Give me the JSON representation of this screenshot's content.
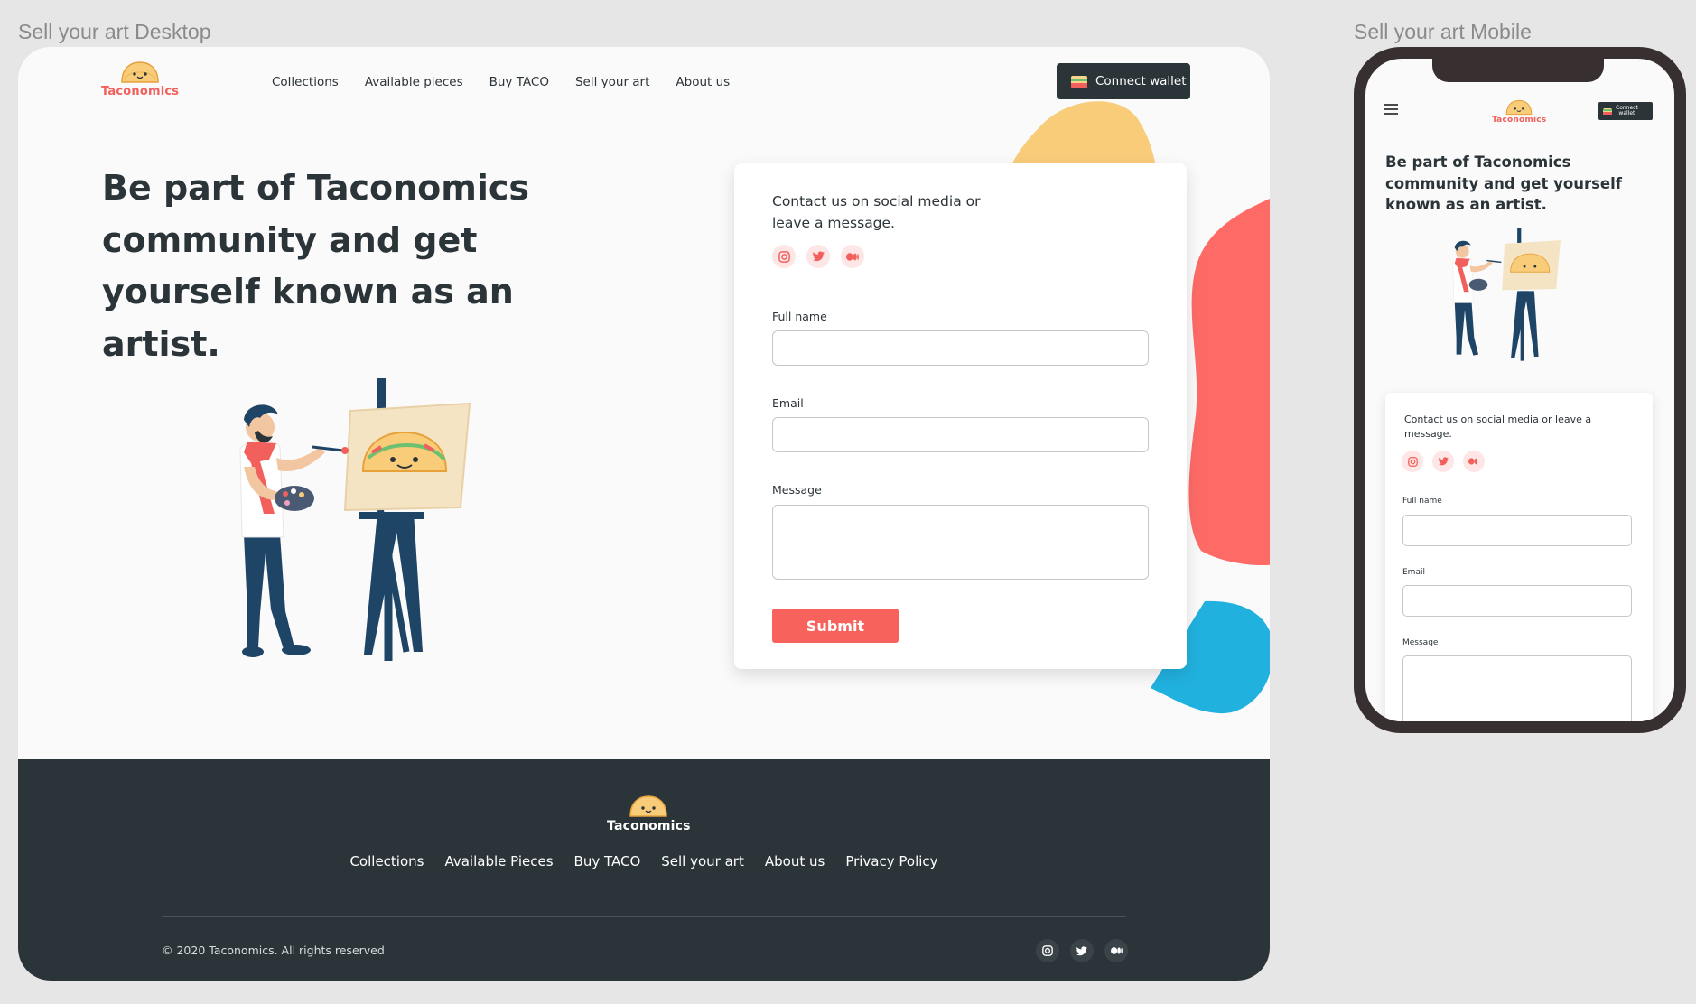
{
  "frames": {
    "desktop_label": "Sell your art Desktop",
    "mobile_label": "Sell your art Mobile"
  },
  "brand": {
    "name": "Taconomics",
    "accent": "#f1605c",
    "dark": "#2b3438",
    "yellow": "#f9cc7a",
    "blue": "#21b1df"
  },
  "nav": {
    "items": [
      {
        "label": "Collections"
      },
      {
        "label": "Available pieces"
      },
      {
        "label": "Buy TACO"
      },
      {
        "label": "Sell your art"
      },
      {
        "label": "About us"
      }
    ],
    "connect_wallet": "Connect wallet"
  },
  "hero": {
    "title": "Be part of Taconomics community and get yourself known as an artist."
  },
  "form": {
    "intro": "Contact us on social media or leave a message.",
    "socials": [
      {
        "icon": "instagram-icon"
      },
      {
        "icon": "twitter-icon"
      },
      {
        "icon": "medium-icon"
      }
    ],
    "full_name_label": "Full name",
    "full_name_value": "",
    "email_label": "Email",
    "email_value": "",
    "message_label": "Message",
    "message_value": "",
    "submit_label": "Submit"
  },
  "footer": {
    "brand": "Taconomics",
    "links": [
      {
        "label": "Collections"
      },
      {
        "label": "Available Pieces"
      },
      {
        "label": "Buy TACO"
      },
      {
        "label": "Sell your art"
      },
      {
        "label": "About us"
      },
      {
        "label": "Privacy Policy"
      }
    ],
    "copyright": "© 2020 Taconomics. All rights reserved"
  },
  "mobile": {
    "connect_wallet_line1": "Connect",
    "connect_wallet_line2": "wallet",
    "title": "Be part of Taconomics community and get yourself known as an artist.",
    "intro": "Contact us on social media or leave a message.",
    "full_name_label": "Full name",
    "email_label": "Email",
    "message_label": "Message"
  }
}
